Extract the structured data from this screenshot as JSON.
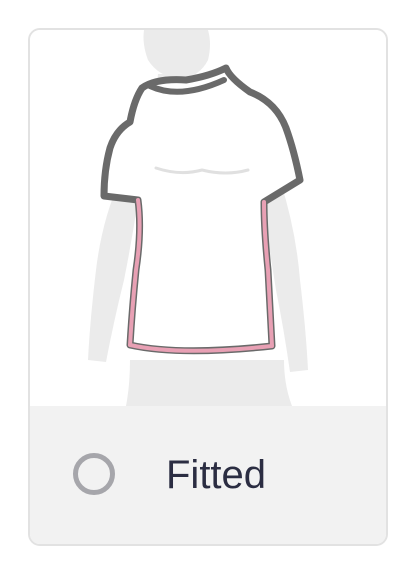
{
  "option": {
    "label": "Fitted",
    "selected": false,
    "illustration_icon": "fitted-tshirt-icon"
  },
  "colors": {
    "card_border": "#e2e2e2",
    "footer_background": "#f2f2f2",
    "radio_border": "#a6a6ab",
    "label_text": "#2b2d42",
    "body_silhouette": "#ebebeb",
    "shirt_outline": "#6a6a6a",
    "fit_highlight": "#e8a0b4"
  }
}
